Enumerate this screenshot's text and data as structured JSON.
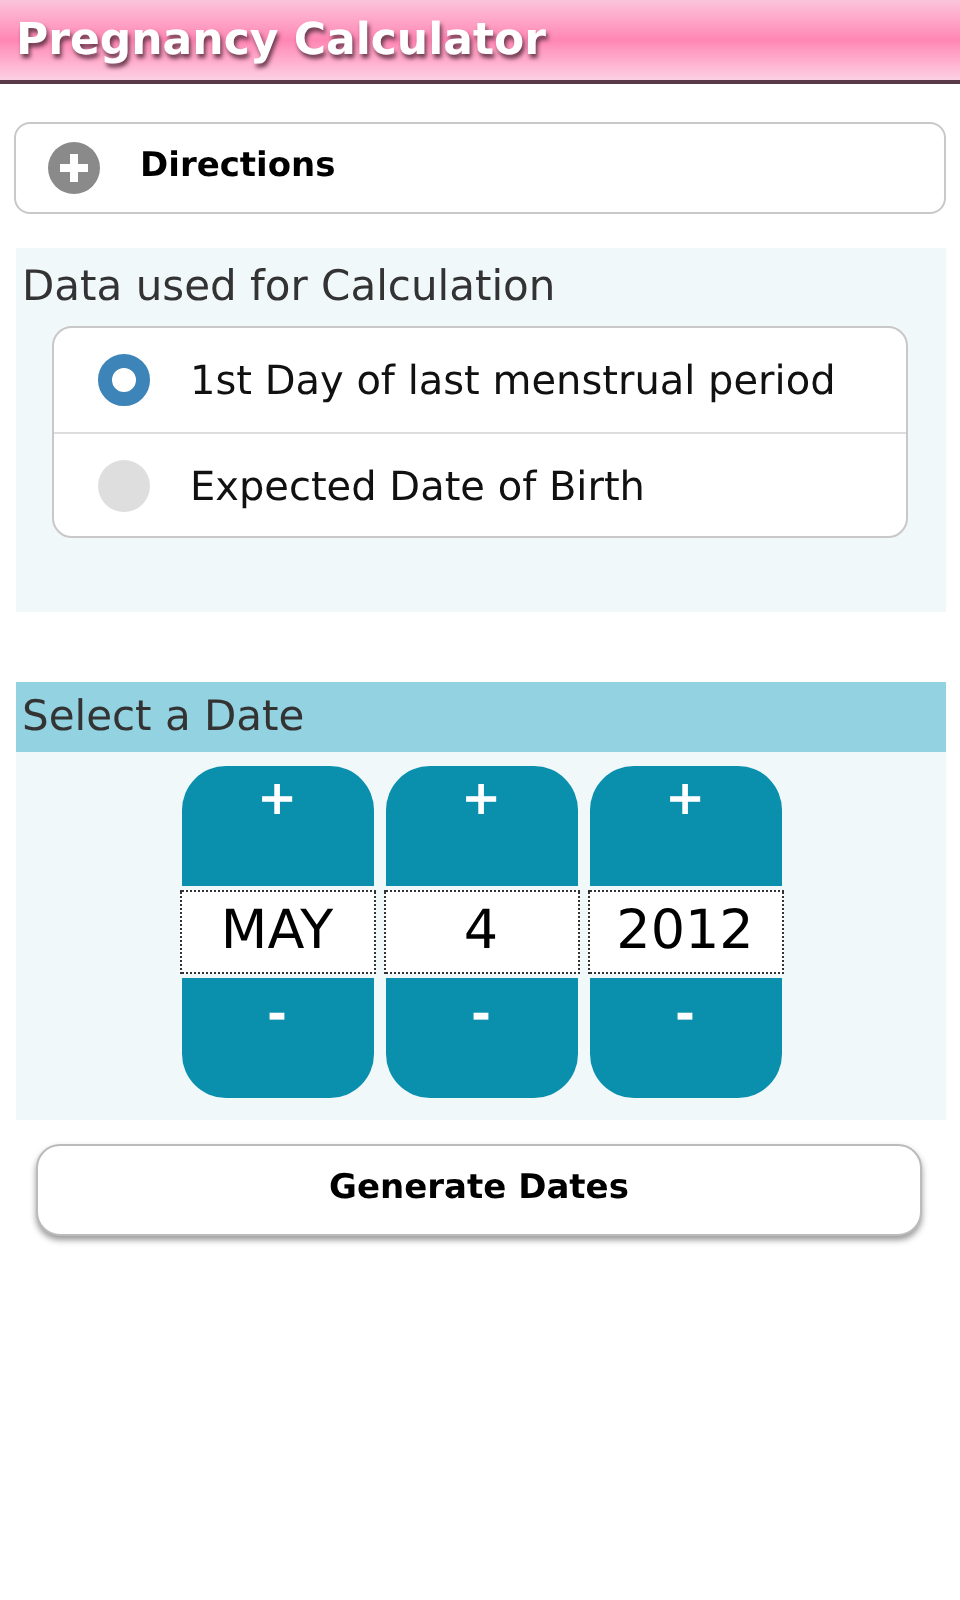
{
  "title_bar": {
    "title": "Pregnancy Calculator"
  },
  "directions": {
    "label": "Directions",
    "expanded": false
  },
  "calculation": {
    "heading": "Data used for Calculation",
    "options": [
      {
        "label": "1st Day of last menstrual period",
        "selected": true
      },
      {
        "label": "Expected Date of Birth",
        "selected": false
      }
    ]
  },
  "date_picker": {
    "heading": "Select a Date",
    "spinners": [
      {
        "increment": "+",
        "value": "MAY",
        "decrement": "-"
      },
      {
        "increment": "+",
        "value": "4",
        "decrement": "-"
      },
      {
        "increment": "+",
        "value": "2012",
        "decrement": "-"
      }
    ]
  },
  "generate_button": {
    "label": "Generate Dates"
  }
}
